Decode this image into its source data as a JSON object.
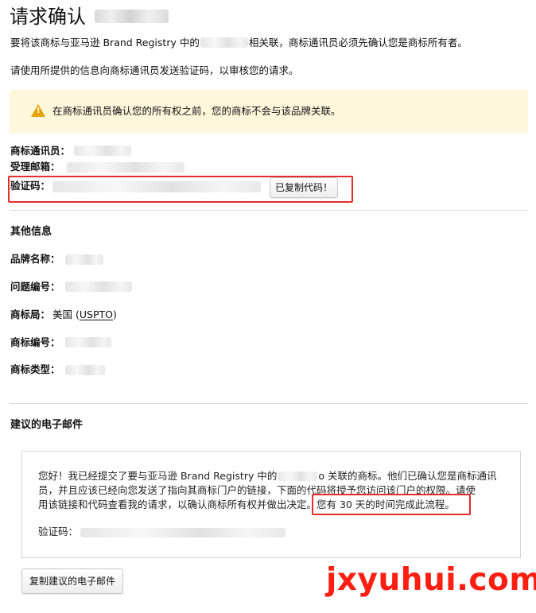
{
  "page": {
    "title": "请求确认",
    "intro": {
      "before_name": "要将该商标与亚马逊 Brand Registry 中的",
      "after_name": "相关联，商标通讯员必须先确认您是商标所有者。"
    },
    "instruction": "请使用所提供的信息向商标通讯员发送验证码，以审核您的请求。"
  },
  "notice": {
    "icon": "warning-icon",
    "text": "在商标通讯员确认您的所有权之前，您的商标不会与该品牌关联。"
  },
  "correspondent": {
    "correspondent_label": "商标通讯员：",
    "email_label": "受理邮箱：",
    "code_label": "验证码：",
    "copy_code_button": "已复制代码！"
  },
  "other_info": {
    "title": "其他信息",
    "brand_label": "品牌名称：",
    "issue_label": "问题编号：",
    "office_label": "商标局：",
    "office_value_prefix": "美国 (",
    "office_value_link": "USPTO",
    "office_value_suffix": ")",
    "tm_number_label": "商标编号：",
    "tm_type_label": "商标类型："
  },
  "suggested_email": {
    "title": "建议的电子邮件",
    "line1_before_name": "您好！我已经提交了要与亚马逊 Brand Registry 中的",
    "line1_after_name": "o 关联的商标。他们已确认您是商标通讯",
    "line2": "员，并且应该已经向您发送了指向其商标门户的链接，下面的代码将授予您访问该门户的权限。请使",
    "line3_prefix": "用该链接和代码查看我的请求，以确认商标所有权并做出决定。",
    "highlight_text": "您有 30 天的时间完成此流程。",
    "code_label": "验证码：",
    "copy_button": "复制建议的电子邮件"
  },
  "watermark": {
    "text": "jxyuhui.com"
  },
  "colors": {
    "warning_background": "#fff7dc",
    "warning_icon": "#e3a400",
    "highlight_red": "#e52d2a",
    "watermark_red": "#ff1f12"
  }
}
